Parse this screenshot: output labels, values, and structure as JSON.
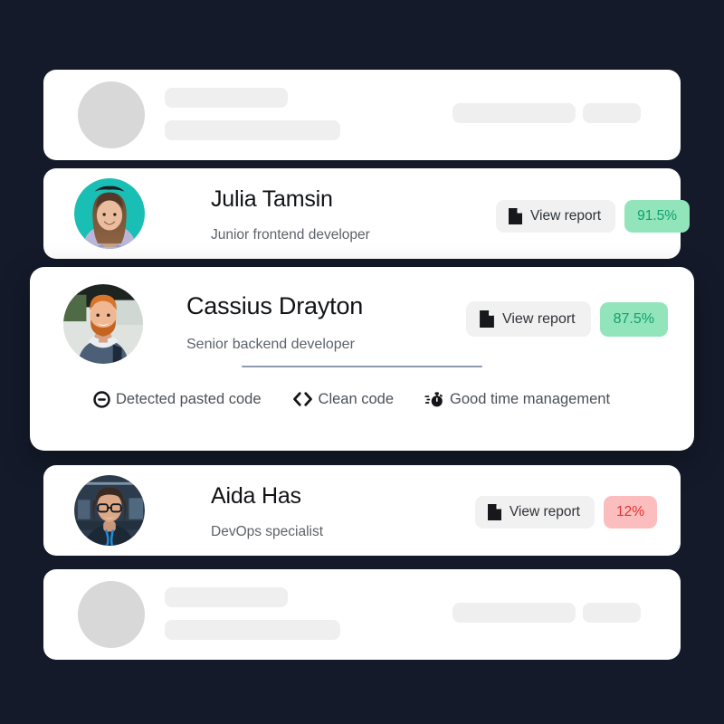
{
  "theme": {
    "background": "#141a2a",
    "card_background": "#ffffff",
    "skeleton_avatar": "#d8d8d8",
    "skeleton_line": "#efefef",
    "button_background": "#f1f1f1",
    "score_good_bg": "#92e5bb",
    "score_good_text": "#109f6d",
    "score_bad_bg": "#fbbdbd",
    "score_bad_text": "#e13232",
    "divider": "#8f9ab5",
    "name_color": "#101215",
    "role_color": "#5d636b"
  },
  "cards": {
    "skeleton_top": {
      "name": "loading-placeholder-card-top"
    },
    "skeleton_bottom": {
      "name": "loading-placeholder-card-bottom"
    },
    "julia": {
      "name": "Julia Tamsin",
      "role": "Junior frontend developer",
      "view_report_label": "View report",
      "report_icon": "document-icon",
      "score": "91.5%",
      "score_state": "good",
      "avatar_icon": "avatar-photo"
    },
    "cassius": {
      "name": "Cassius Drayton",
      "role": "Senior backend developer",
      "view_report_label": "View report",
      "report_icon": "document-icon",
      "score": "87.5%",
      "score_state": "good",
      "avatar_icon": "avatar-photo",
      "tags": [
        {
          "label": "Detected pasted code",
          "icon": "minus-circle-icon"
        },
        {
          "label": "Clean code",
          "icon": "code-brackets-icon"
        },
        {
          "label": "Good time management",
          "icon": "stopwatch-icon"
        }
      ]
    },
    "aida": {
      "name": "Aida Has",
      "role": "DevOps specialist",
      "view_report_label": "View report",
      "report_icon": "document-icon",
      "score": "12%",
      "score_state": "bad",
      "avatar_icon": "avatar-photo"
    }
  }
}
